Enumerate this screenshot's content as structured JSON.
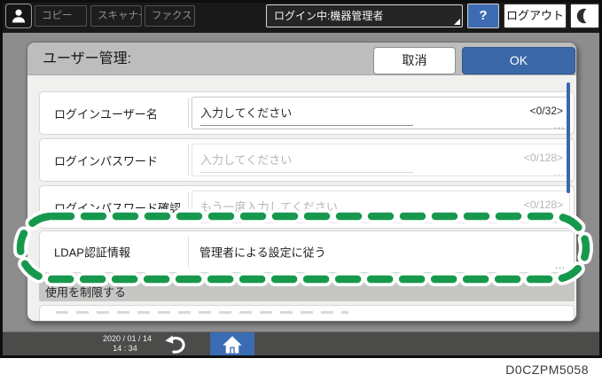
{
  "topbar": {
    "tabs": [
      {
        "label": "コピー"
      },
      {
        "label": "スキャナー"
      },
      {
        "label": "ファクス"
      }
    ],
    "login_status": "ログイン中:機器管理者",
    "help_label": "?",
    "logout_label": "ログアウト"
  },
  "dialog": {
    "title": "ユーザー管理:",
    "cancel_label": "取消",
    "ok_label": "OK",
    "rows": [
      {
        "label": "ログインユーザー名",
        "placeholder": "入力してください",
        "counter": "<0/32>",
        "more": "..."
      },
      {
        "label": "ログインパスワード",
        "placeholder": "入力してください",
        "counter": "<0/128>",
        "more": "..."
      },
      {
        "label": "ログインパスワード確認",
        "placeholder": "もう一度入力してください",
        "counter": "<0/128>",
        "more": "..."
      },
      {
        "label": "LDAP認証情報",
        "value": "管理者による設定に従う",
        "more": "..."
      }
    ],
    "section_header": "使用を制限する"
  },
  "bottombar": {
    "date": "2020 / 01 / 14",
    "time": "14 : 34"
  },
  "caption": "D0CZPM5058",
  "icons": {
    "user": "person-icon",
    "moon": "crescent-moon-icon",
    "back": "undo-arrow-icon",
    "home": "home-icon"
  },
  "colors": {
    "accent_blue": "#3b68a9",
    "annotation_green": "#17994d",
    "topbar_bg": "#191919",
    "screen_bg": "#8d8d8d",
    "bottombar_bg": "#4b4b49"
  }
}
